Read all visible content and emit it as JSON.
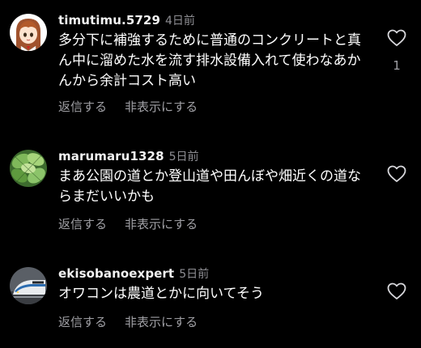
{
  "comments": [
    {
      "username": "timutimu.5729",
      "time": "4日前",
      "text": "多分下に補強するために普通のコンクリートと真ん中に溜めた水を流す排水設備入れて使わなあかんから余計コスト高い",
      "reply_label": "返信する",
      "hide_label": "非表示にする",
      "like_count": "1",
      "avatar": "anime-girl-avatar"
    },
    {
      "username": "marumaru1328",
      "time": "5日前",
      "text": "まあ公園の道とか登山道や田んぼや畑近くの道ならまだいいかも",
      "reply_label": "返信する",
      "hide_label": "非表示にする",
      "like_count": "",
      "avatar": "green-leaves-avatar"
    },
    {
      "username": "ekisobanoexpert",
      "time": "5日前",
      "text": "オワコンは農道とかに向いてそう",
      "reply_label": "返信する",
      "hide_label": "非表示にする",
      "like_count": "",
      "avatar": "train-avatar"
    }
  ],
  "icons": {
    "like": "heart-outline-icon"
  },
  "colors": {
    "background": "#000000",
    "text": "#ffffff",
    "secondary": "#8e8e93"
  }
}
